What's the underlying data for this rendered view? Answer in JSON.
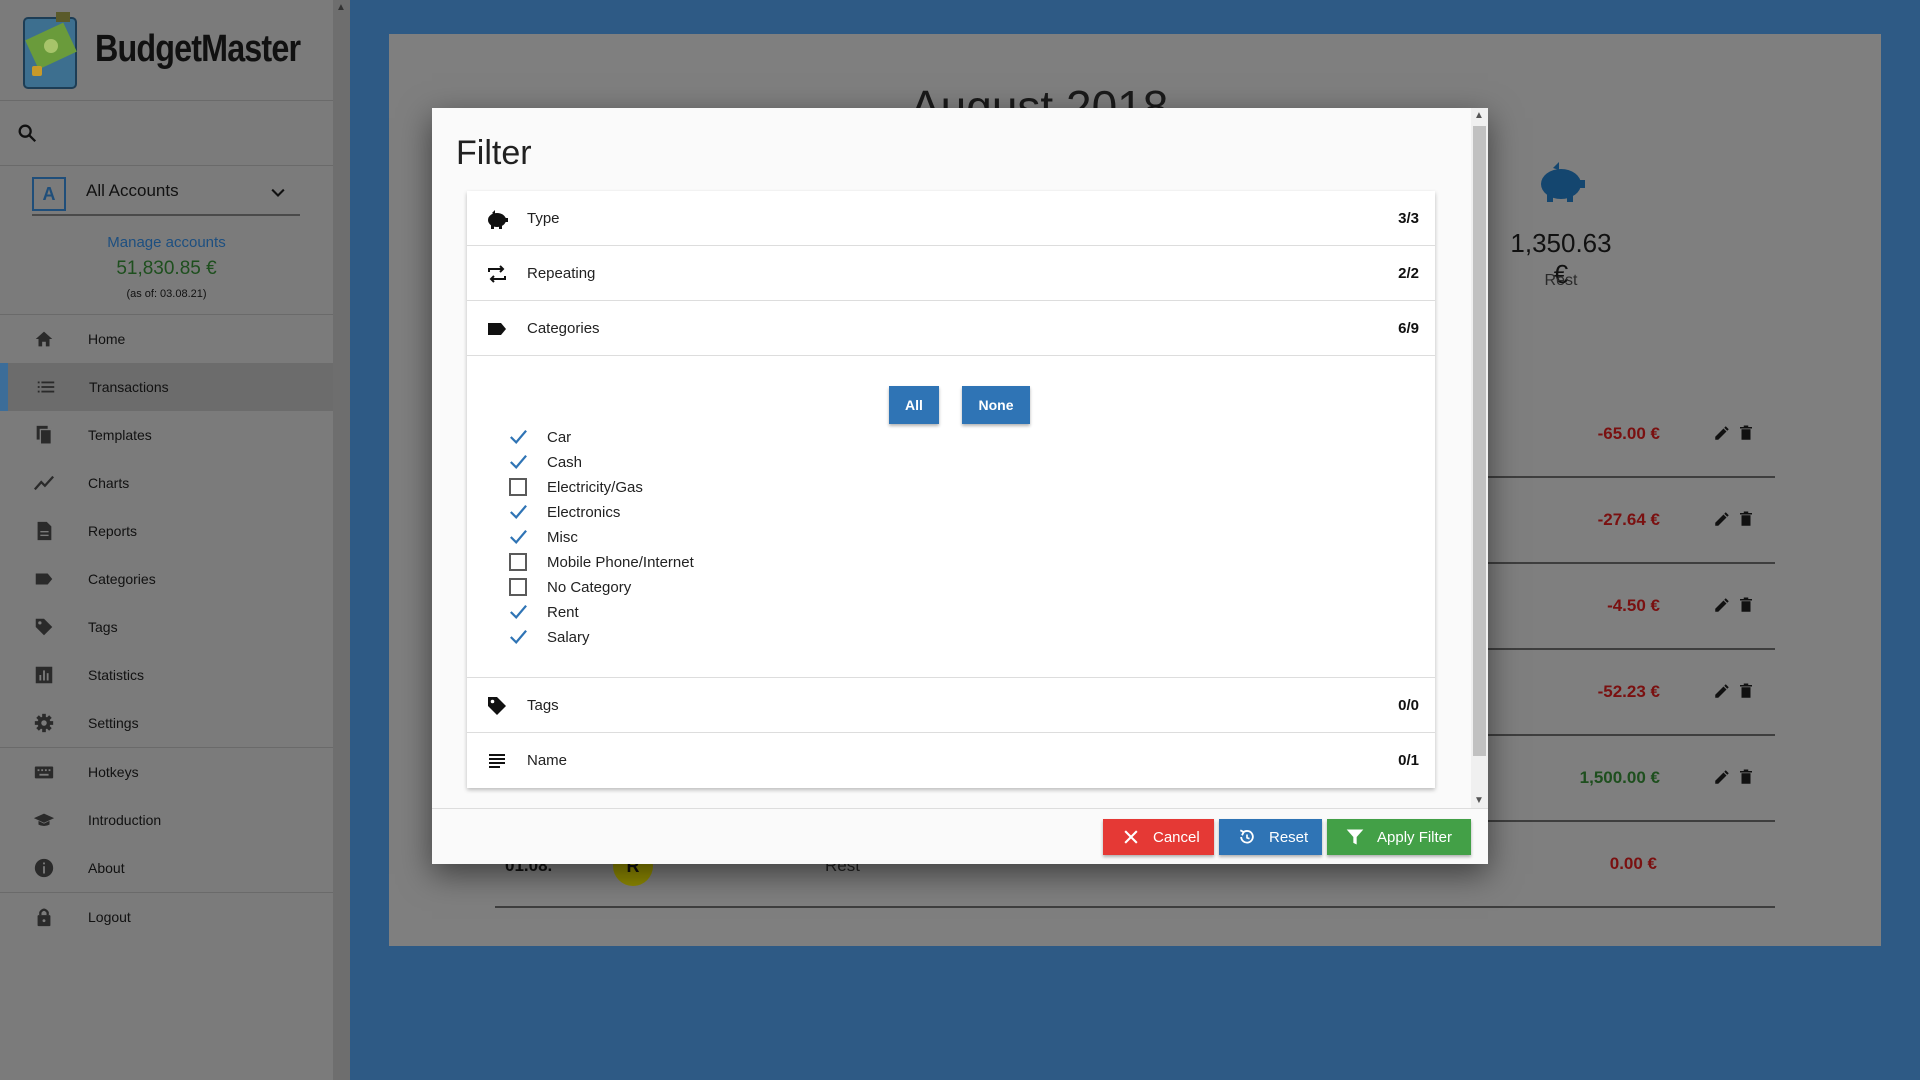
{
  "app": {
    "brand": "BudgetMaster"
  },
  "account": {
    "badge": "A",
    "name": "All Accounts",
    "manage_label": "Manage accounts",
    "balance": "51,830.85 €",
    "as_of": "(as of: 03.08.21)"
  },
  "nav": {
    "items": [
      {
        "label": "Home",
        "icon": "home-icon"
      },
      {
        "label": "Transactions",
        "icon": "list-icon",
        "active": true
      },
      {
        "label": "Templates",
        "icon": "templates-icon"
      },
      {
        "label": "Charts",
        "icon": "chart-line-icon"
      },
      {
        "label": "Reports",
        "icon": "report-icon"
      },
      {
        "label": "Categories",
        "icon": "label-icon"
      },
      {
        "label": "Tags",
        "icon": "tag-icon"
      },
      {
        "label": "Statistics",
        "icon": "bar-chart-icon"
      },
      {
        "label": "Settings",
        "icon": "gear-icon"
      },
      {
        "label": "Hotkeys",
        "icon": "keyboard-icon"
      },
      {
        "label": "Introduction",
        "icon": "school-icon"
      },
      {
        "label": "About",
        "icon": "info-icon"
      },
      {
        "label": "Logout",
        "icon": "lock-icon"
      }
    ]
  },
  "background": {
    "month_label": "August 2018",
    "rest_amount": "1,350.63 €",
    "rest_label": "Rest",
    "transactions": [
      {
        "amount": "-65.00 €",
        "color": "#7a1010"
      },
      {
        "amount": "-27.64 €",
        "color": "#7a1010"
      },
      {
        "amount": "-4.50 €",
        "color": "#7a1010"
      },
      {
        "amount": "-52.23 €",
        "color": "#7a1010"
      },
      {
        "amount": "1,500.00 €",
        "color": "#1e4f1e"
      },
      {
        "date": "01.08.",
        "badge": "R",
        "name": "Rest",
        "amount": "0.00 €",
        "color": "#7a1010"
      }
    ]
  },
  "filter": {
    "title": "Filter",
    "sections": {
      "type": {
        "label": "Type",
        "count": "3/3"
      },
      "repeating": {
        "label": "Repeating",
        "count": "2/2"
      },
      "categories": {
        "label": "Categories",
        "count": "6/9"
      },
      "tags": {
        "label": "Tags",
        "count": "0/0"
      },
      "name": {
        "label": "Name",
        "count": "0/1"
      }
    },
    "all_label": "All",
    "none_label": "None",
    "categories": [
      {
        "label": "Car",
        "checked": true
      },
      {
        "label": "Cash",
        "checked": true
      },
      {
        "label": "Electricity/Gas",
        "checked": false
      },
      {
        "label": "Electronics",
        "checked": true
      },
      {
        "label": "Misc",
        "checked": true
      },
      {
        "label": "Mobile Phone/Internet",
        "checked": false
      },
      {
        "label": "No Category",
        "checked": false
      },
      {
        "label": "Rent",
        "checked": true
      },
      {
        "label": "Salary",
        "checked": true
      }
    ],
    "buttons": {
      "cancel": "Cancel",
      "reset": "Reset",
      "apply": "Apply Filter"
    }
  },
  "colors": {
    "accent": "#2f74b5",
    "cancel": "#e53935",
    "apply": "#43a047",
    "positive": "#2e7d32",
    "negative": "#c62828"
  }
}
